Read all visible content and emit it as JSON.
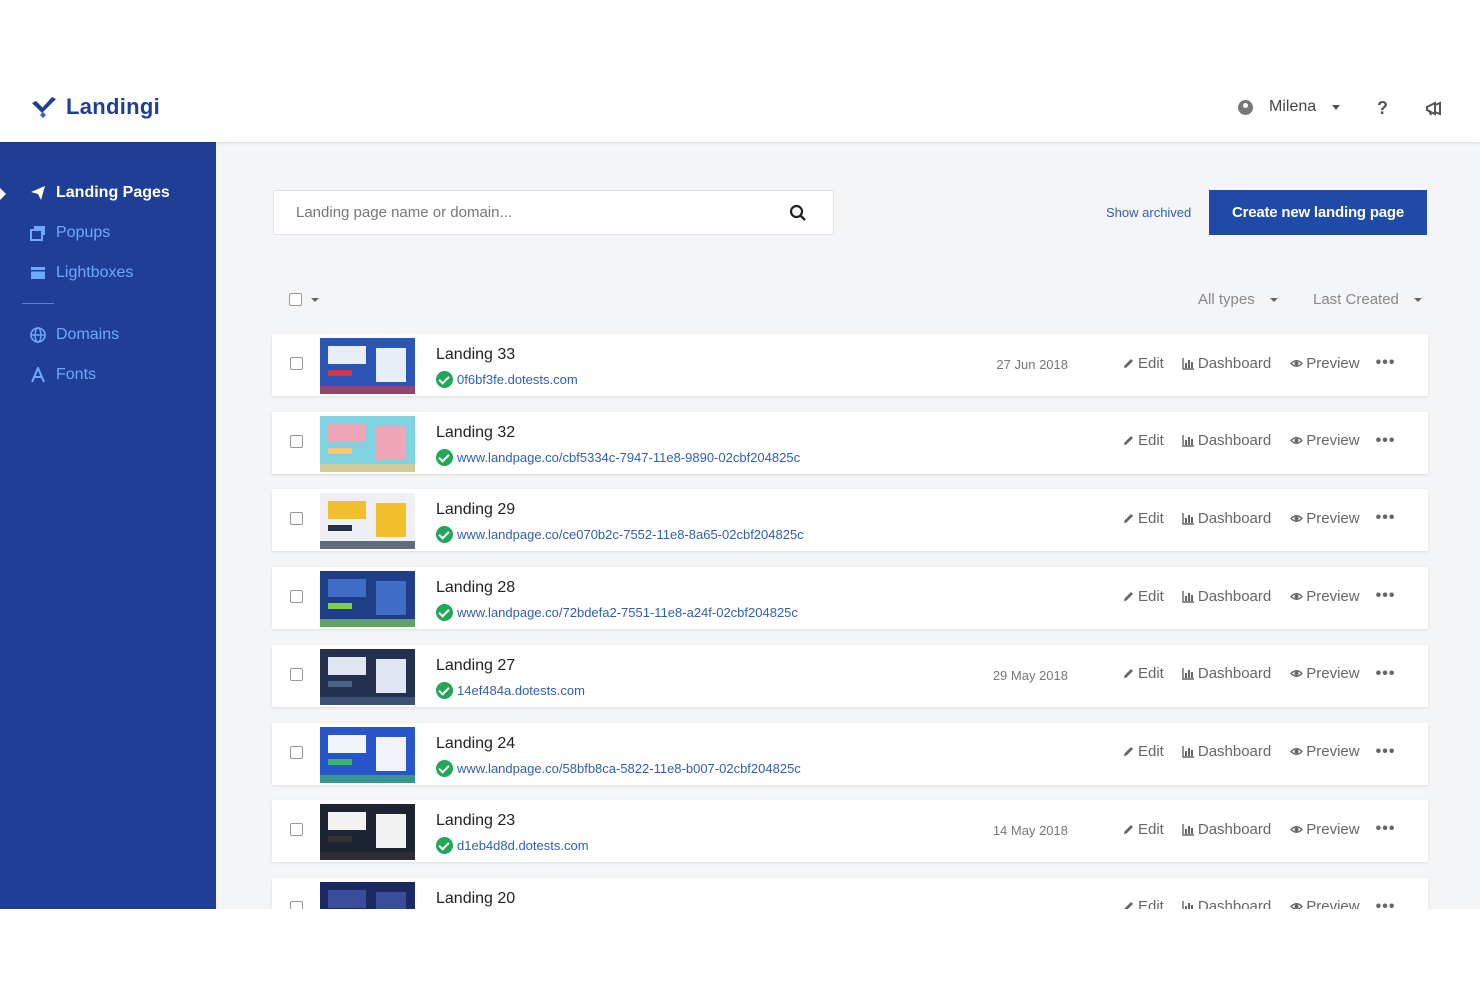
{
  "brand": {
    "name": "Landingi",
    "color": "#1e3f94"
  },
  "header": {
    "user_name": "Milena",
    "help_label": "?"
  },
  "sidebar": {
    "items": [
      {
        "label": "Landing Pages",
        "icon": "paper-plane-icon",
        "active": true
      },
      {
        "label": "Popups",
        "icon": "popups-icon",
        "active": false
      },
      {
        "label": "Lightboxes",
        "icon": "lightbox-icon",
        "active": false
      },
      {
        "label": "Domains",
        "icon": "globe-icon",
        "active": false
      },
      {
        "label": "Fonts",
        "icon": "font-icon",
        "active": false
      }
    ]
  },
  "toolbar": {
    "search_placeholder": "Landing page name or domain...",
    "show_archived": "Show archived",
    "create_label": "Create new landing page"
  },
  "filters": {
    "type": "All types",
    "sort": "Last Created"
  },
  "actions": {
    "edit": "Edit",
    "dashboard": "Dashboard",
    "preview": "Preview",
    "more": "•••"
  },
  "rows": [
    {
      "title": "Landing 33",
      "url": "0f6bf3fe.dotests.com",
      "date": "27 Jun 2018",
      "thumb": [
        "#2b56b8",
        "#e9edf5",
        "#c93a4a"
      ]
    },
    {
      "title": "Landing 32",
      "url": "www.landpage.co/cbf5334c-7947-11e8-9890-02cbf204825c",
      "date": "",
      "thumb": [
        "#7fd3e0",
        "#f0a5b8",
        "#f4c979"
      ]
    },
    {
      "title": "Landing 29",
      "url": "www.landpage.co/ce070b2c-7552-11e8-8a65-02cbf204825c",
      "date": "",
      "thumb": [
        "#eef0f3",
        "#f2c02c",
        "#26324a"
      ]
    },
    {
      "title": "Landing 28",
      "url": "www.landpage.co/72bdefa2-7551-11e8-a24f-02cbf204825c",
      "date": "",
      "thumb": [
        "#1e3f86",
        "#3f6cc4",
        "#7fd04b"
      ]
    },
    {
      "title": "Landing 27",
      "url": "14ef484a.dotests.com",
      "date": "29 May 2018",
      "thumb": [
        "#23314f",
        "#dfe6f1",
        "#4a5f88"
      ]
    },
    {
      "title": "Landing 24",
      "url": "www.landpage.co/58bfb8ca-5822-11e8-b007-02cbf204825c",
      "date": "",
      "thumb": [
        "#2856c8",
        "#f0f3f8",
        "#3cb371"
      ]
    },
    {
      "title": "Landing 23",
      "url": "d1eb4d8d.dotests.com",
      "date": "14 May 2018",
      "thumb": [
        "#1d2433",
        "#f2f2f2",
        "#333333"
      ]
    },
    {
      "title": "Landing 20",
      "url": "",
      "date": "",
      "thumb": [
        "#1b2a63",
        "#3a4d9a",
        "#e7e7ee"
      ]
    }
  ]
}
